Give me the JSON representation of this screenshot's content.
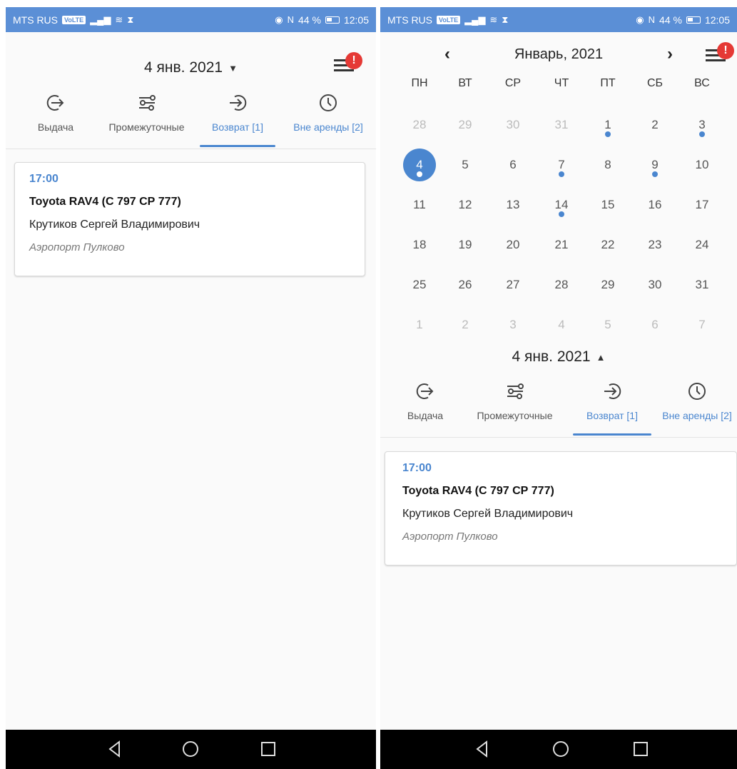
{
  "statusbar": {
    "carrier": "MTS RUS",
    "volte": "VoLTE",
    "signal_glyph": "▂▄▆",
    "wifi_glyph": "≋",
    "hourglass_glyph": "⧗",
    "eye_glyph": "◉",
    "nfc_glyph": "N",
    "battery_text": "44 %",
    "time": "12:05"
  },
  "header": {
    "date_label": "4 янв. 2021",
    "caret_down": "▼",
    "caret_up": "▲",
    "menu_badge": "!"
  },
  "tabs": [
    {
      "label": "Выдача",
      "icon": "exit-arrow-icon"
    },
    {
      "label": "Промежуточные",
      "icon": "route-icon"
    },
    {
      "label": "Возврат [1]",
      "icon": "enter-arrow-icon"
    },
    {
      "label": "Вне аренды [2]",
      "icon": "clock-icon"
    }
  ],
  "card": {
    "time": "17:00",
    "car": "Toyota RAV4 (С 797 СР 777)",
    "name": "Крутиков Сергей Владимирович",
    "place": "Аэропорт Пулково"
  },
  "calendar": {
    "title": "Январь, 2021",
    "prev": "‹",
    "next": "›",
    "weekdays": [
      "ПН",
      "ВТ",
      "СР",
      "ЧТ",
      "ПТ",
      "СБ",
      "ВС"
    ],
    "weeks": [
      [
        {
          "d": "28",
          "m": true
        },
        {
          "d": "29",
          "m": true
        },
        {
          "d": "30",
          "m": true
        },
        {
          "d": "31",
          "m": true
        },
        {
          "d": "1",
          "dot": true
        },
        {
          "d": "2"
        },
        {
          "d": "3",
          "dot": true
        }
      ],
      [
        {
          "d": "4",
          "sel": true,
          "dot": true
        },
        {
          "d": "5"
        },
        {
          "d": "6"
        },
        {
          "d": "7",
          "dot": true
        },
        {
          "d": "8"
        },
        {
          "d": "9",
          "dot": true
        },
        {
          "d": "10"
        }
      ],
      [
        {
          "d": "11"
        },
        {
          "d": "12"
        },
        {
          "d": "13"
        },
        {
          "d": "14",
          "dot": true
        },
        {
          "d": "15"
        },
        {
          "d": "16"
        },
        {
          "d": "17"
        }
      ],
      [
        {
          "d": "18"
        },
        {
          "d": "19"
        },
        {
          "d": "20"
        },
        {
          "d": "21"
        },
        {
          "d": "22"
        },
        {
          "d": "23"
        },
        {
          "d": "24"
        }
      ],
      [
        {
          "d": "25"
        },
        {
          "d": "26"
        },
        {
          "d": "27"
        },
        {
          "d": "28"
        },
        {
          "d": "29"
        },
        {
          "d": "30"
        },
        {
          "d": "31"
        }
      ],
      [
        {
          "d": "1",
          "m": true
        },
        {
          "d": "2",
          "m": true
        },
        {
          "d": "3",
          "m": true
        },
        {
          "d": "4",
          "m": true
        },
        {
          "d": "5",
          "m": true
        },
        {
          "d": "6",
          "m": true
        },
        {
          "d": "7",
          "m": true
        }
      ]
    ]
  },
  "colors": {
    "statusbar": "#5b8fd6",
    "accent": "#4a86cf",
    "badge": "#e53935",
    "navbar": "#000000"
  }
}
